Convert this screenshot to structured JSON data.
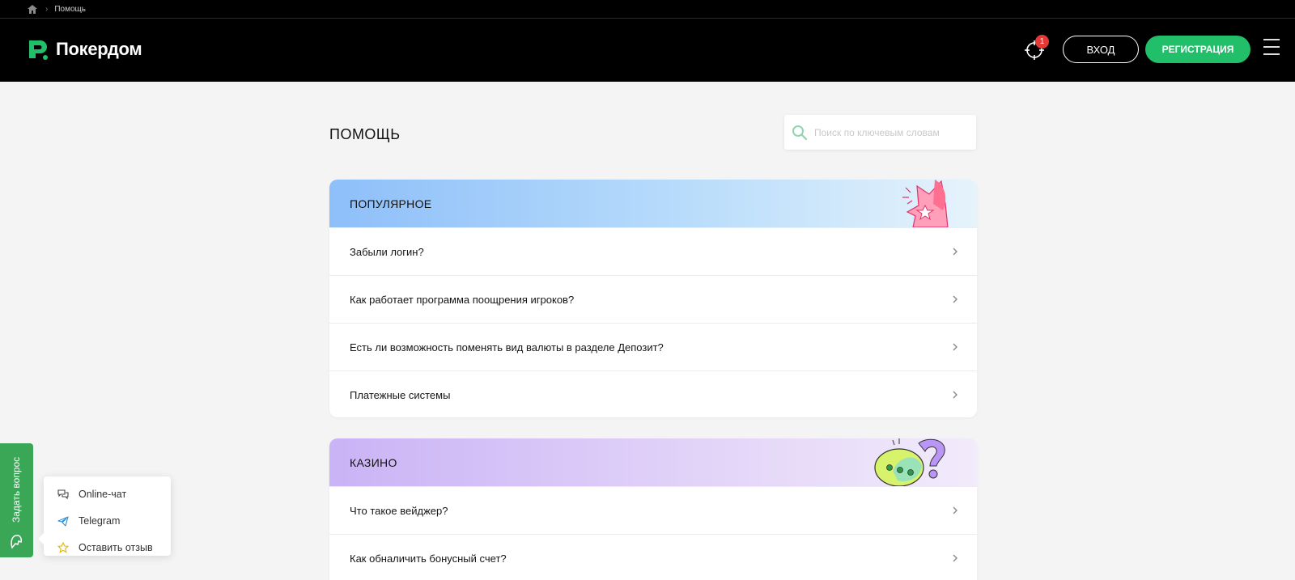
{
  "breadcrumb": {
    "current": "Помощь"
  },
  "header": {
    "brand": "Покердом",
    "notification_count": "1",
    "login_label": "ВХОД",
    "register_label": "РЕГИСТРАЦИЯ"
  },
  "page": {
    "title": "ПОМОЩЬ",
    "search_placeholder": "Поиск по ключевым словам"
  },
  "sections": [
    {
      "title": "ПОПУЛЯРНОЕ",
      "items": [
        "Забыли логин?",
        "Как работает программа поощрения игроков?",
        "Есть ли возможность поменять вид валюты в разделе Депозит?",
        "Платежные системы"
      ]
    },
    {
      "title": "КАЗИНО",
      "items": [
        "Что такое вейджер?",
        "Как обналичить бонусный счет?"
      ]
    }
  ],
  "support": {
    "tab_label": "Задать вопрос",
    "items": [
      {
        "label": "Online-чат",
        "icon": "chat-icon"
      },
      {
        "label": "Telegram",
        "icon": "telegram-icon"
      },
      {
        "label": "Оставить отзыв",
        "icon": "star-icon"
      }
    ]
  },
  "colors": {
    "brand_green": "#22bf6a",
    "badge_red": "#e53935",
    "popular_header": "#8ebff9",
    "casino_header": "#cab3f6"
  }
}
